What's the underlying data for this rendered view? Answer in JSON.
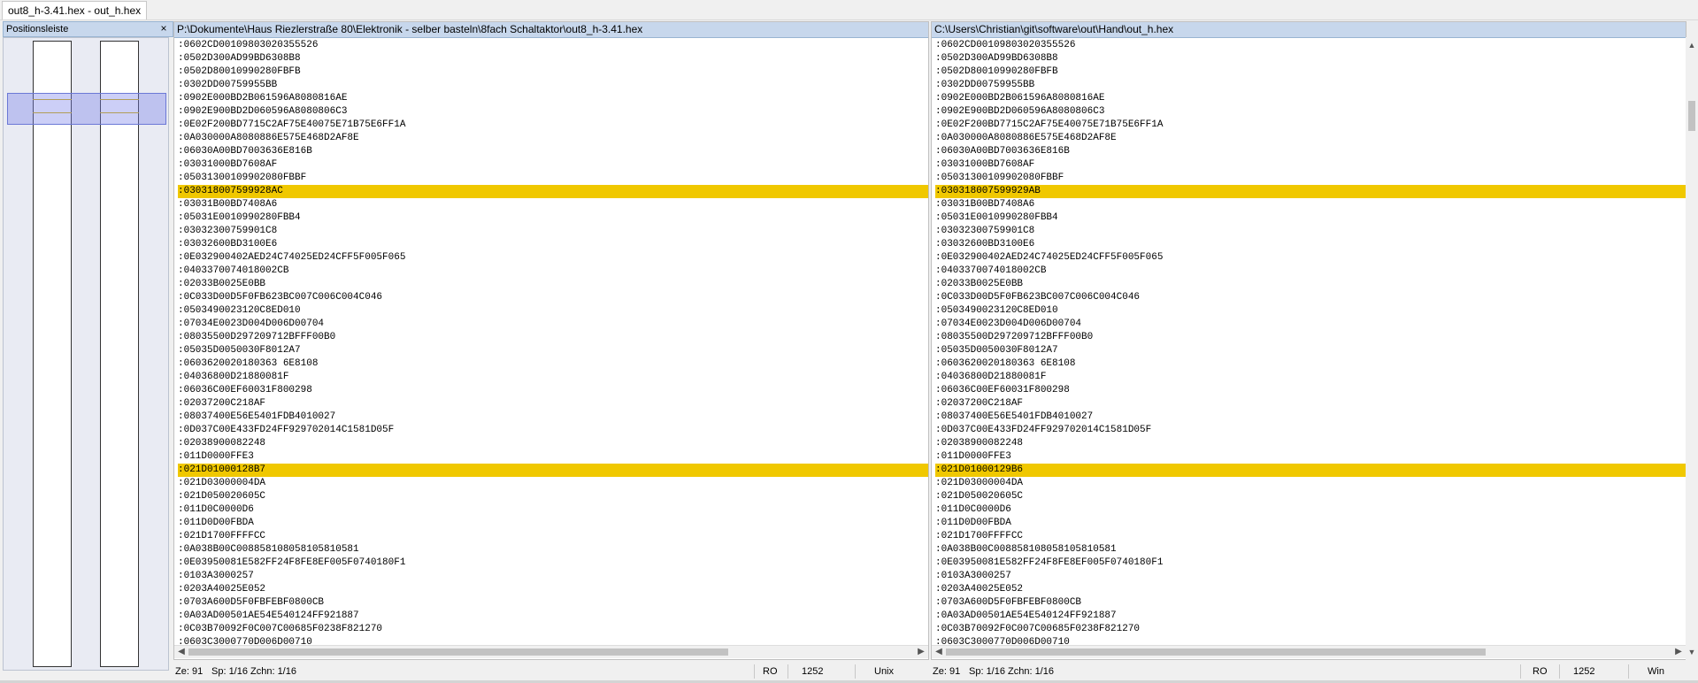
{
  "tab": {
    "label": "out8_h-3.41.hex - out_h.hex"
  },
  "position_bar": {
    "title": "Positionsleiste",
    "close_label": "×"
  },
  "left_pane": {
    "path": "P:\\Dokumente\\Haus Riezlerstraße 80\\Elektronik - selber basteln\\8fach Schaltaktor\\out8_h-3.41.hex",
    "lines": [
      ":0602CD00109803020355526",
      ":0502D300AD99BD6308B8",
      ":0502D80010990280FBFB",
      ":0302DD00759955BB",
      ":0902E000BD2B061596A8080816AE",
      ":0902E900BD2D060596A8080806C3",
      ":0E02F200BD7715C2AF75E40075E71B75E6FF1A",
      ":0A030000A8080886E575E468D2AF8E",
      ":06030A00BD7003636E816B",
      ":03031000BD7608AF",
      ":05031300109902080FBBF",
      ":030318007599928AC",
      ":03031B00BD7408A6",
      ":05031E0010990280FBB4",
      ":03032300759901C8",
      ":03032600BD3100E6",
      ":0E032900402AED24C74025ED24CFF5F005F065",
      ":0403370074018002CB",
      ":02033B0025E0BB",
      ":0C033D00D5F0FB623BC007C006C004C046",
      ":0503490023120C8ED010",
      ":07034E0023D004D006D00704",
      ":08035500D297209712BFFF00B0",
      ":05035D0050030F8012A7",
      ":0603620020180363 6E8108",
      ":04036800D21880081F",
      ":06036C00EF60031F800298",
      ":02037200C218AF",
      ":08037400E56E5401FDB4010027",
      ":0D037C00E433FD24FF929702014C1581D05F",
      ":02038900082248",
      ":011D0000FFE3",
      ":021D01000128B7",
      ":021D03000004DA",
      ":021D050020605C",
      ":011D0C0000D6",
      ":011D0D00FBDA",
      ":021D1700FFFFCC",
      ":0A038B00C008858108058105810581",
      ":0E03950081E582FF24F8FE8EF005F0740180F1",
      ":0103A3000257",
      ":0203A40025E052",
      ":0703A600D5F0FBFEBF0800CB",
      ":0A03AD00501AE54E540124FF921887",
      ":0C03B70092F0C007C00685F0238F821270",
      ":0603C3000770D006D00710"
    ],
    "status": {
      "line": "Ze: 91",
      "col": "Sp: 1/16",
      "char": "Zchn: 1/16",
      "mode": "RO",
      "codepage": "1252",
      "eol": "Unix"
    }
  },
  "right_pane": {
    "path": "C:\\Users\\Christian\\git\\software\\out\\Hand\\out_h.hex",
    "lines": [
      ":0602CD00109803020355526",
      ":0502D300AD99BD6308B8",
      ":0502D80010990280FBFB",
      ":0302DD00759955BB",
      ":0902E000BD2B061596A8080816AE",
      ":0902E900BD2D060596A8080806C3",
      ":0E02F200BD7715C2AF75E40075E71B75E6FF1A",
      ":0A030000A8080886E575E468D2AF8E",
      ":06030A00BD7003636E816B",
      ":03031000BD7608AF",
      ":05031300109902080FBBF",
      ":030318007599929AB",
      ":03031B00BD7408A6",
      ":05031E0010990280FBB4",
      ":03032300759901C8",
      ":03032600BD3100E6",
      ":0E032900402AED24C74025ED24CFF5F005F065",
      ":0403370074018002CB",
      ":02033B0025E0BB",
      ":0C033D00D5F0FB623BC007C006C004C046",
      ":0503490023120C8ED010",
      ":07034E0023D004D006D00704",
      ":08035500D297209712BFFF00B0",
      ":05035D0050030F8012A7",
      ":0603620020180363 6E8108",
      ":04036800D21880081F",
      ":06036C00EF60031F800298",
      ":02037200C218AF",
      ":08037400E56E5401FDB4010027",
      ":0D037C00E433FD24FF929702014C1581D05F",
      ":02038900082248",
      ":011D0000FFE3",
      ":021D01000129B6",
      ":021D03000004DA",
      ":021D050020605C",
      ":011D0C0000D6",
      ":011D0D00FBDA",
      ":021D1700FFFFCC",
      ":0A038B00C008858108058105810581",
      ":0E03950081E582FF24F8FE8EF005F0740180F1",
      ":0103A3000257",
      ":0203A40025E052",
      ":0703A600D5F0FBFEBF0800CB",
      ":0A03AD00501AE54E540124FF921887",
      ":0C03B70092F0C007C00685F0238F821270",
      ":0603C3000770D006D00710"
    ],
    "status": {
      "line": "Ze: 91",
      "col": "Sp: 1/16",
      "char": "Zchn: 1/16",
      "mode": "RO",
      "codepage": "1252",
      "eol": "Win"
    }
  },
  "diff_line_indexes": [
    11,
    32
  ],
  "colors": {
    "diff_highlight": "#f0c800",
    "header_bg": "#c7d7ec",
    "position_view": "#7882eb"
  }
}
